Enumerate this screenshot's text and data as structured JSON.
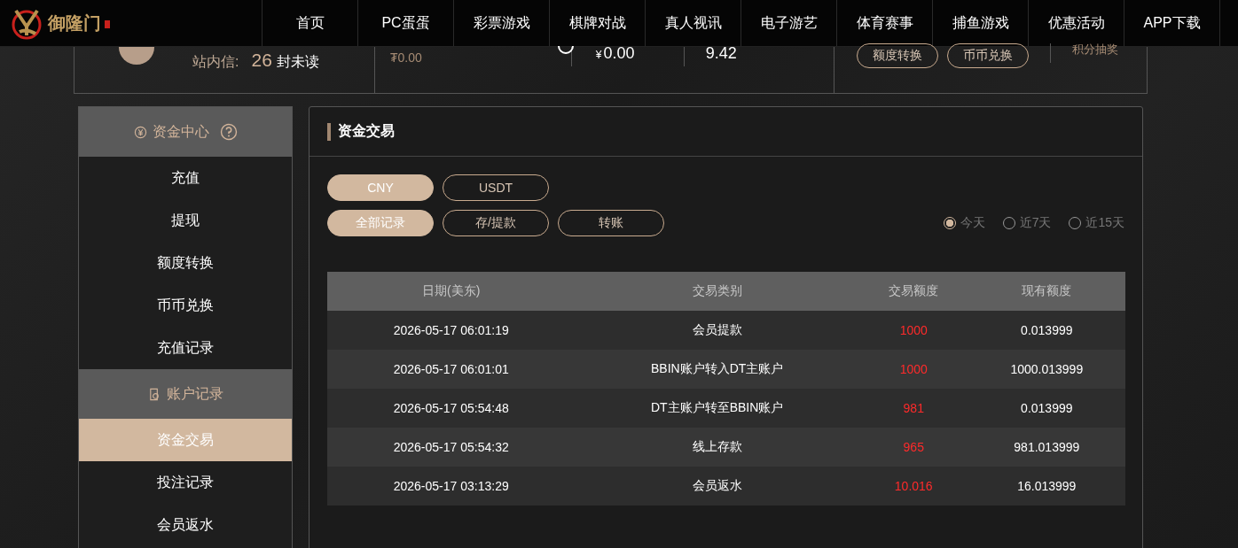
{
  "nav": {
    "logo_text": "御隆门",
    "items": [
      "首页",
      "PC蛋蛋",
      "彩票游戏",
      "棋牌对战",
      "真人视讯",
      "电子游艺",
      "体育赛事",
      "捕鱼游戏",
      "优惠活动",
      "APP下载"
    ]
  },
  "profile": {
    "messages_label": "站内信:",
    "unread_count": "26",
    "unread_suffix": "封未读",
    "usdt_balance": "₮0.00",
    "cny_symbol": "¥",
    "cny_amount": "0.00",
    "points": "9.42",
    "buttons": [
      "额度转换",
      "币币兑换"
    ],
    "link": "积分抽奖"
  },
  "sidebar": [
    {
      "title": "资金中心",
      "kind": "money",
      "help": true,
      "items": [
        {
          "label": "充值",
          "selected": false
        },
        {
          "label": "提现",
          "selected": false
        },
        {
          "label": "额度转换",
          "selected": false
        },
        {
          "label": "币币兑换",
          "selected": false
        },
        {
          "label": "充值记录",
          "selected": false
        }
      ]
    },
    {
      "title": "账户记录",
      "kind": "record",
      "help": false,
      "items": [
        {
          "label": "资金交易",
          "selected": true
        },
        {
          "label": "投注记录",
          "selected": false
        },
        {
          "label": "会员返水",
          "selected": false
        }
      ]
    }
  ],
  "content": {
    "title": "资金交易",
    "currency_tabs": [
      {
        "label": "CNY",
        "selected": true
      },
      {
        "label": "USDT",
        "selected": false
      }
    ],
    "record_tabs": [
      {
        "label": "全部记录",
        "selected": true
      },
      {
        "label": "存/提款",
        "selected": false
      },
      {
        "label": "转账",
        "selected": false
      }
    ],
    "ranges": [
      {
        "label": "今天",
        "selected": true
      },
      {
        "label": "近7天",
        "selected": false
      },
      {
        "label": "近15天",
        "selected": false
      }
    ],
    "table": {
      "columns": [
        "日期(美东)",
        "交易类别",
        "交易额度",
        "现有额度"
      ],
      "rows": [
        [
          "2026-05-17 06:01:19",
          "会员提款",
          "1000",
          "0.013999"
        ],
        [
          "2026-05-17 06:01:01",
          "BBIN账户转入DT主账户",
          "1000",
          "1000.013999"
        ],
        [
          "2026-05-17 05:54:48",
          "DT主账户转至BBIN账户",
          "981",
          "0.013999"
        ],
        [
          "2026-05-17 05:54:32",
          "线上存款",
          "965",
          "981.013999"
        ],
        [
          "2026-05-17 03:13:29",
          "会员返水",
          "10.016",
          "16.013999"
        ]
      ]
    }
  }
}
